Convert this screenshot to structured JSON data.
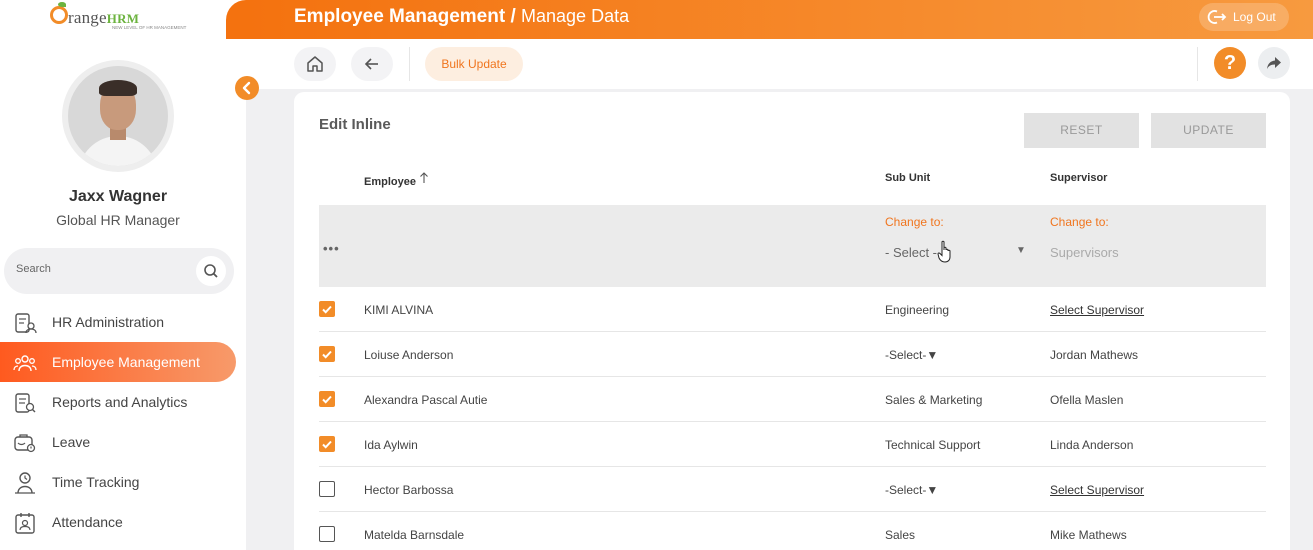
{
  "brand": {
    "name_prefix": "range",
    "name_suffix": "HRM",
    "tagline": "NEW LEVEL OF HR MANAGEMENT"
  },
  "user": {
    "name": "Jaxx Wagner",
    "role": "Global HR Manager"
  },
  "sidebar": {
    "search_placeholder": "Search",
    "items": [
      {
        "label": "HR Administration",
        "icon": "hr-admin-icon"
      },
      {
        "label": "Employee Management",
        "icon": "employees-icon",
        "active": true
      },
      {
        "label": "Reports and Analytics",
        "icon": "reports-icon"
      },
      {
        "label": "Leave",
        "icon": "leave-icon"
      },
      {
        "label": "Time Tracking",
        "icon": "time-tracking-icon"
      },
      {
        "label": "Attendance",
        "icon": "attendance-icon"
      }
    ]
  },
  "header": {
    "title": "Employee Management /",
    "subtitle": "Manage Data",
    "logout_label": "Log Out"
  },
  "toolbar": {
    "bulk_update_label": "Bulk Update"
  },
  "main": {
    "title": "Edit Inline",
    "reset_label": "RESET",
    "update_label": "UPDATE",
    "columns": {
      "employee": "Employee",
      "sub_unit": "Sub Unit",
      "supervisor": "Supervisor"
    },
    "change_row": {
      "change_to_label": "Change to:",
      "sub_unit_select": "- Select -",
      "supervisor_placeholder": "Supervisors"
    },
    "rows": [
      {
        "checked": true,
        "employee": "KIMI ALVINA",
        "sub_unit": "Engineering",
        "supervisor": "Select Supervisor",
        "supervisor_link": true
      },
      {
        "checked": true,
        "employee": "Loiuse Anderson",
        "sub_unit": "-Select-▼",
        "supervisor": "Jordan Mathews",
        "supervisor_link": false
      },
      {
        "checked": true,
        "employee": "Alexandra Pascal Autie",
        "sub_unit": "Sales & Marketing",
        "supervisor": "Ofella Maslen",
        "supervisor_link": false
      },
      {
        "checked": true,
        "employee": "Ida Aylwin",
        "sub_unit": "Technical Support",
        "supervisor": "Linda Anderson",
        "supervisor_link": false
      },
      {
        "checked": false,
        "employee": "Hector Barbossa",
        "sub_unit": "-Select-▼",
        "supervisor": "Select Supervisor",
        "supervisor_link": true
      },
      {
        "checked": false,
        "employee": "Matelda Barnsdale",
        "sub_unit": "Sales",
        "supervisor": "Mike Mathews",
        "supervisor_link": false
      }
    ]
  },
  "colors": {
    "accent": "#f28c28",
    "brand_green": "#6cb33f"
  }
}
